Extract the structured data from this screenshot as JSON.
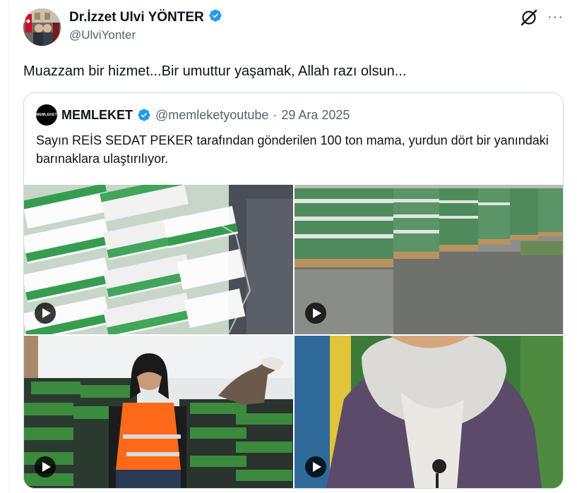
{
  "post": {
    "author_name": "Dr.İzzet Ulvi YÖNTER",
    "author_handle": "@UlviYonter",
    "text": "Muazzam bir hizmet...Bir umuttur yaşamak, Allah razı olsun...",
    "verified_icon": "verified-badge-icon",
    "grok_icon": "grok-icon",
    "more_icon": "more-options-icon",
    "more_glyph": "···"
  },
  "quote": {
    "avatar_text": "MEMLEKET",
    "author_name": "MEMLEKET",
    "author_handle": "@memleketyoutube",
    "separator": "·",
    "date": "29 Ara 2025",
    "text": "Sayın REİS SEDAT PEKER tarafından gönderilen 100 ton mama, yurdun dört bir yanındaki barınaklara ulaştırılıyor.",
    "media": [
      {
        "type": "video",
        "description_icon": "play-icon"
      },
      {
        "type": "video",
        "description_icon": "play-icon"
      },
      {
        "type": "video",
        "description_icon": "play-icon"
      },
      {
        "type": "video",
        "description_icon": "play-icon"
      }
    ]
  },
  "colors": {
    "text_primary": "#0f1419",
    "text_secondary": "#536471",
    "border": "#cfd9de",
    "verified_blue": "#1d9bf0"
  }
}
